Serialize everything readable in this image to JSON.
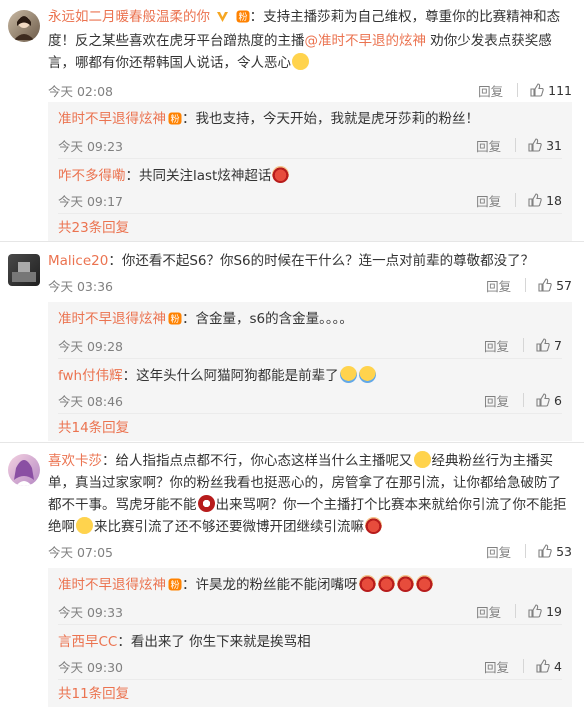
{
  "labels": {
    "reply": "回复"
  },
  "comments": [
    {
      "user": "永远如二月暖春般温柔的你",
      "colon": "：",
      "text_a": "支持主播莎莉为自己维权，尊重你的比赛精神和态度！反之某些喜欢在虎牙平台蹭热度的主播",
      "mention": "@准时不早退的炫神",
      "text_b": " 劝你少发表点获奖感言，哪都有你还帮韩国人说话，令人恶心",
      "time": "今天 02:08",
      "likes": "111",
      "replies": [
        {
          "user": "准时不早退得炫神",
          "text": "我也支持，今天开始，我就是虎牙莎莉的粉丝！",
          "time": "今天 09:23",
          "likes": "31"
        },
        {
          "user": "咋不多得嘞",
          "text": "共同关注last炫神超话",
          "time": "今天 09:17",
          "likes": "18"
        }
      ],
      "more": "共23条回复"
    },
    {
      "user": "Malice20",
      "colon": "：",
      "text_a": "你还看不起S6？你S6的时候在干什么？连一点对前辈的尊敬都没了？",
      "time": "今天 03:36",
      "likes": "57",
      "replies": [
        {
          "user": "准时不早退得炫神",
          "text": "含金量，s6的含金量。。。。",
          "time": "今天 09:28",
          "likes": "7"
        },
        {
          "user": "fwh付伟辉",
          "text": "这年头什么阿猫阿狗都能是前辈了",
          "time": "今天 08:46",
          "likes": "6"
        }
      ],
      "more": "共14条回复"
    },
    {
      "user": "喜欢卡莎",
      "colon": "：",
      "text_a": "给人指指点点都不行，你心态这样当什么主播呢又",
      "text_b": "经典粉丝行为主播买单，真当过家家啊？你的粉丝我看也挺恶心的，房管拿了在那引流，让你都给急破防了都不干事。骂虎牙能不能",
      "text_c": "出来骂啊？你一个主播打个比赛本来就给你引流了你不能拒绝啊",
      "text_d": "来比赛引流了还不够还要微博开团继续引流嘛",
      "time": "今天 07:05",
      "likes": "53",
      "replies": [
        {
          "user": "准时不早退得炫神",
          "text": "许昊龙的粉丝能不能闭嘴呀",
          "time": "今天 09:33",
          "likes": "19"
        },
        {
          "user": "言西早CC",
          "text": "看出来了  你生下来就是挨骂相",
          "time": "今天 09:30",
          "likes": "4"
        }
      ],
      "more": "共11条回复"
    }
  ]
}
